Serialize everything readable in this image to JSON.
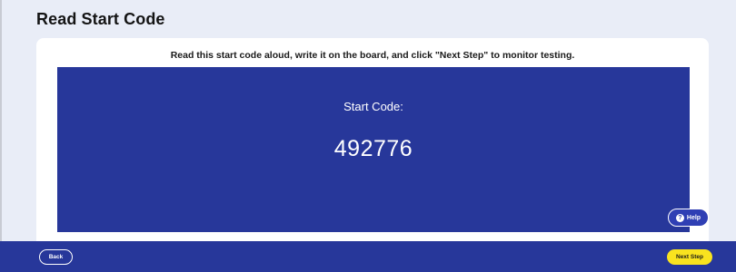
{
  "page": {
    "title": "Read Start Code",
    "instruction": "Read this start code aloud, write it on the board, and click \"Next Step\" to monitor testing."
  },
  "code_panel": {
    "label": "Start Code:",
    "value": "492776"
  },
  "help": {
    "label": "Help",
    "icon": "question-circle-icon",
    "icon_glyph": "?"
  },
  "footer": {
    "back_label": "Back",
    "next_label": "Next Step"
  },
  "colors": {
    "background": "#e9edf7",
    "brand_blue": "#27379a",
    "help_button": "#2f3fb4",
    "next_button": "#f9e31f"
  }
}
